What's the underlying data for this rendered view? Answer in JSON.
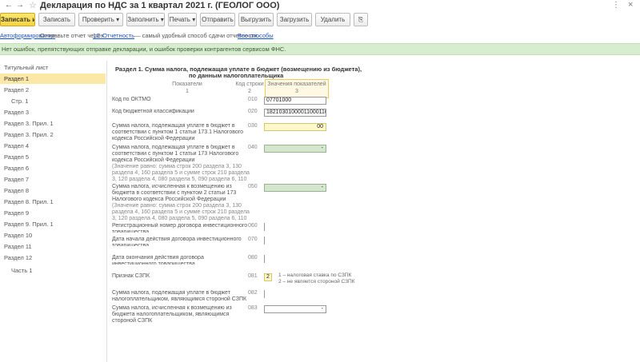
{
  "window": {
    "title": "Декларация по НДС за 1 квартал 2021 г. (ГЕОЛОГ ООО)",
    "back_glyph": "←",
    "forward_glyph": "→",
    "star_glyph": "☆",
    "menu_glyph": "⋮",
    "close_glyph": "×"
  },
  "toolbar": {
    "buttons": [
      {
        "label": "Записать и закрыть",
        "primary": true
      },
      {
        "label": "Записать"
      },
      {
        "label": "Проверить ▾"
      },
      {
        "label": "Заполнить ▾"
      },
      {
        "label": "Печать ▾"
      },
      {
        "label": "Отправить"
      },
      {
        "label": "Выгрузить"
      },
      {
        "label": "Загрузить"
      },
      {
        "label": "Удалить"
      },
      {
        "label": "Ещё ▾"
      }
    ],
    "clip_glyph": "⎘"
  },
  "linkbar": {
    "link1": "Автоформирование",
    "text1": "Отправьте отчет через",
    "link2": "1С-Отчетность",
    "text2": "— самый удобный способ сдачи отчетности.",
    "link3": "Все способы"
  },
  "notice": "Нет ошибок, препятствующих отправке декларации, и ошибок проверки контрагентов сервисом ФНС.",
  "sidebar": {
    "items": [
      {
        "label": "Титульный лист",
        "indent": 0,
        "active": false
      },
      {
        "label": "Раздел 1",
        "indent": 0,
        "active": true
      },
      {
        "label": "Раздел 2",
        "indent": 0,
        "active": false
      },
      {
        "label": "Стр. 1",
        "indent": 1,
        "active": false
      },
      {
        "label": "Раздел 3",
        "indent": 0,
        "active": false
      },
      {
        "label": "Раздел 3. Прил. 1",
        "indent": 0,
        "active": false
      },
      {
        "label": "Раздел 3. Прил. 2",
        "indent": 0,
        "active": false
      },
      {
        "label": "Раздел 4",
        "indent": 0,
        "active": false
      },
      {
        "label": "Раздел 5",
        "indent": 0,
        "active": false
      },
      {
        "label": "Раздел 6",
        "indent": 0,
        "active": false
      },
      {
        "label": "Раздел 7",
        "indent": 0,
        "active": false
      },
      {
        "label": "Раздел 8",
        "indent": 0,
        "active": false
      },
      {
        "label": "Раздел 8. Прил. 1",
        "indent": 0,
        "active": false
      },
      {
        "label": "Раздел 9",
        "indent": 0,
        "active": false
      },
      {
        "label": "Раздел 9. Прил. 1",
        "indent": 0,
        "active": false
      },
      {
        "label": "Раздел 10",
        "indent": 0,
        "active": false
      },
      {
        "label": "Раздел 11",
        "indent": 0,
        "active": false
      },
      {
        "label": "Раздел 12",
        "indent": 0,
        "active": false
      },
      {
        "label": "Часть 1",
        "indent": 1,
        "active": false
      }
    ]
  },
  "section": {
    "heading_line1": "Раздел 1. Сумма налога, подлежащая уплате в бюджет (возмещению из бюджета),",
    "heading_line2": "по данным налогоплательщика",
    "col_indicator": "Показатели",
    "col_indicator_num": "1",
    "col_code": "Код строки",
    "col_code_num": "2",
    "col_value": "Значения показателей",
    "col_value_num": "3"
  },
  "rows": [
    {
      "label": "Код по ОКТМО",
      "sub": "",
      "code": "010",
      "value": "07701000",
      "kind": "plain"
    },
    {
      "label": "Код бюджетной классификации",
      "sub": "",
      "code": "020",
      "value": "18210301000011000110",
      "kind": "plain"
    },
    {
      "label": "Сумма налога, подлежащая уплате в бюджет в соответствии с пунктом 1 статьи 173.1 Налогового кодекса Российской Федерации",
      "sub": "",
      "code": "030",
      "value": "00",
      "kind": "yellow"
    },
    {
      "label": "Сумма налога, подлежащая уплате в бюджет в соответствии с пунктом 1 статьи 173 Налогового кодекса Российской Федерации",
      "sub": "(Значение равно: сумма строк 200 раздела 3, 130 раздела 4, 160 раздела 5 и сумме строк 210 раздела 3, 120 раздела 4, 080 раздела 5, 090 раздела 6, 110 раздела 6 > 0)",
      "code": "040",
      "value": "-",
      "kind": "green"
    },
    {
      "label": "Сумма налога, исчисленная к возмещению из бюджета в соответствии с пунктом 2 статьи 173 Налогового кодекса Российской Федерации",
      "sub": "(Значение равно: сумма строк 200 раздела 3, 130 раздела 4, 160 раздела 5 и сумме строк 210 раздела 3, 120 раздела 4, 080 раздела 5, 090 раздела 6, 110 раздела 6 < 0)",
      "code": "050",
      "value": "-",
      "kind": "green"
    },
    {
      "label": "Регистрационный номер договора инвестиционного товарищества",
      "sub": "",
      "code": "060",
      "value": "",
      "kind": "empty"
    },
    {
      "label": "Дата начала действия договора инвестиционного товарищества",
      "sub": "",
      "code": "070",
      "value": "",
      "kind": "empty"
    },
    {
      "label": "Дата окончания действия договора инвестиционного товарищества",
      "sub": "",
      "code": "080",
      "value": "",
      "kind": "empty"
    },
    {
      "label": "Признак СЗПК",
      "sub": "",
      "code": "081",
      "value": "2",
      "kind": "small",
      "hint1": "1 – налоговая ставка по СЗПК",
      "hint2": "2 – не является стороной СЗПК"
    },
    {
      "label": "Сумма налога, подлежащая уплате в бюджет налогоплательщиком, являющимся стороной СЗПК",
      "sub": "",
      "code": "082",
      "value": "",
      "kind": "empty"
    },
    {
      "label": "Сумма налога, исчисленная к возмещению из бюджета налогоплательщиком, являющимся стороной СЗПК",
      "sub": "",
      "code": "083",
      "value": "-",
      "kind": "plainright"
    }
  ]
}
